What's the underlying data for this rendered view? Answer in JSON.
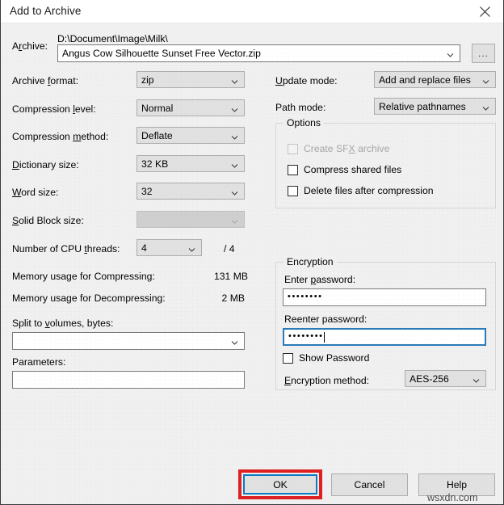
{
  "window": {
    "title": "Add to Archive",
    "close_icon": "close-icon"
  },
  "archive": {
    "label": "Archive:",
    "label_pre": "A",
    "label_accel": "r",
    "label_post": "chive:",
    "path": "D:\\Document\\Image\\Milk\\",
    "value": "Angus Cow Silhouette Sunset Free Vector.zip",
    "browse_label": "..."
  },
  "left_fields": [
    {
      "label_pre": "Archive ",
      "accel": "f",
      "label_post": "ormat:",
      "value": "zip",
      "disabled": false,
      "name": "archive-format"
    },
    {
      "label_pre": "Compression ",
      "accel": "l",
      "label_post": "evel:",
      "value": "Normal",
      "disabled": false,
      "name": "compression-level"
    },
    {
      "label_pre": "Compression ",
      "accel": "m",
      "label_post": "ethod:",
      "value": "Deflate",
      "disabled": false,
      "name": "compression-method"
    },
    {
      "label_pre": "",
      "accel": "D",
      "label_post": "ictionary size:",
      "value": "32 KB",
      "disabled": false,
      "name": "dictionary-size"
    },
    {
      "label_pre": "",
      "accel": "W",
      "label_post": "ord size:",
      "value": "32",
      "disabled": false,
      "name": "word-size"
    },
    {
      "label_pre": "",
      "accel": "S",
      "label_post": "olid Block size:",
      "value": "",
      "disabled": true,
      "name": "solid-block-size"
    }
  ],
  "cpu_threads": {
    "label_pre": "Number of CPU ",
    "accel": "t",
    "label_post": "hreads:",
    "value": "4",
    "total": "/ 4"
  },
  "memory": {
    "compress_label": "Memory usage for Compressing:",
    "compress_value": "131 MB",
    "decompress_label": "Memory usage for Decompressing:",
    "decompress_value": "2 MB"
  },
  "split": {
    "label_pre": "Split to ",
    "accel": "v",
    "label_post": "olumes, bytes:",
    "value": ""
  },
  "parameters": {
    "label": "Parameters:",
    "value": ""
  },
  "right_fields": [
    {
      "label_pre": "",
      "accel": "U",
      "label_post": "pdate mode:",
      "value": "Add and replace files",
      "name": "update-mode"
    },
    {
      "label_pre": "Path mode:",
      "accel": "",
      "label_post": "",
      "value": "Relative pathnames",
      "name": "path-mode"
    }
  ],
  "options": {
    "title": "Options",
    "items": [
      {
        "label_pre": "Create SF",
        "accel": "X",
        "label_post": " archive",
        "checked": false,
        "disabled": true,
        "name": "create-sfx-archive"
      },
      {
        "label_pre": "Compress shared files",
        "accel": "",
        "label_post": "",
        "checked": false,
        "disabled": false,
        "name": "compress-shared-files"
      },
      {
        "label_pre": "Delete files after compression",
        "accel": "",
        "label_post": "",
        "checked": false,
        "disabled": false,
        "name": "delete-files-after-compression"
      }
    ]
  },
  "encryption": {
    "title": "Encryption",
    "enter_password_label_pre": "Enter ",
    "enter_password_accel": "p",
    "enter_password_label_post": "assword:",
    "enter_password_value": "••••••••",
    "reenter_password_label": "Reenter password:",
    "reenter_password_value": "••••••••",
    "show_password_label": "Show Password",
    "show_password_checked": false,
    "method_label_pre": "",
    "method_accel": "E",
    "method_label_post": "ncryption method:",
    "method_value": "AES-256"
  },
  "buttons": {
    "ok": "OK",
    "cancel": "Cancel",
    "help": "Help"
  },
  "watermark": "wsxdn.com",
  "colors": {
    "highlight_red": "#e02020",
    "focus_blue": "#0a7ac4",
    "dialog_bg": "#f0f0f0",
    "control_bg": "#e1e1e1"
  }
}
